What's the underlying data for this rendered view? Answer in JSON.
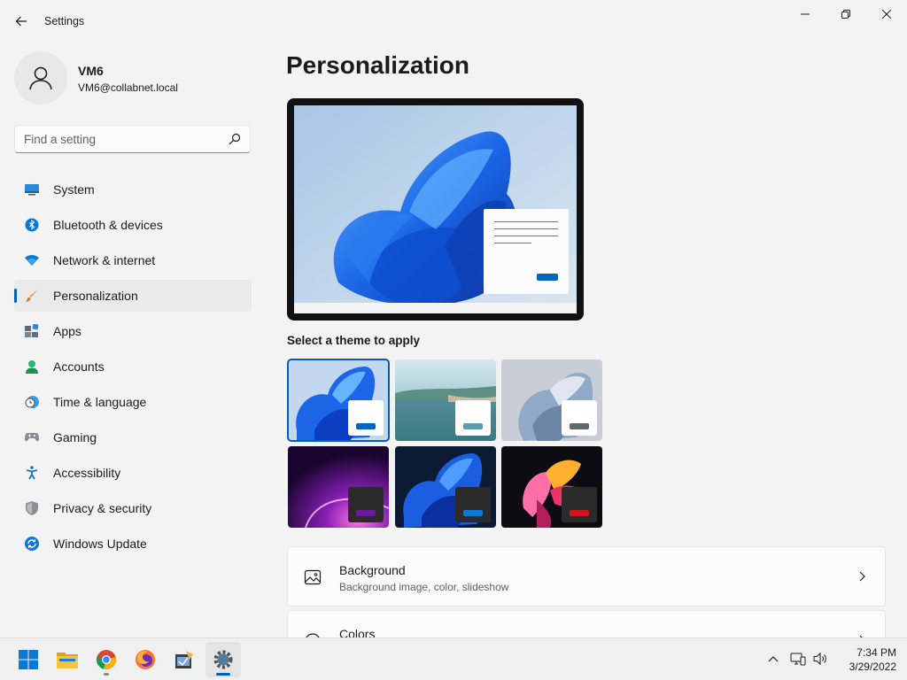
{
  "window": {
    "title": "Settings"
  },
  "profile": {
    "name": "VM6",
    "email": "VM6@collabnet.local"
  },
  "search": {
    "placeholder": "Find a setting"
  },
  "sidebar": {
    "items": [
      {
        "label": "System",
        "icon": "system-icon",
        "selected": false
      },
      {
        "label": "Bluetooth & devices",
        "icon": "bluetooth-icon",
        "selected": false
      },
      {
        "label": "Network & internet",
        "icon": "wifi-icon",
        "selected": false
      },
      {
        "label": "Personalization",
        "icon": "brush-icon",
        "selected": true
      },
      {
        "label": "Apps",
        "icon": "apps-icon",
        "selected": false
      },
      {
        "label": "Accounts",
        "icon": "accounts-icon",
        "selected": false
      },
      {
        "label": "Time & language",
        "icon": "clock-globe-icon",
        "selected": false
      },
      {
        "label": "Gaming",
        "icon": "gamepad-icon",
        "selected": false
      },
      {
        "label": "Accessibility",
        "icon": "accessibility-icon",
        "selected": false
      },
      {
        "label": "Privacy & security",
        "icon": "shield-icon",
        "selected": false
      },
      {
        "label": "Windows Update",
        "icon": "update-icon",
        "selected": false
      }
    ]
  },
  "main": {
    "title": "Personalization",
    "themes_label": "Select a theme to apply",
    "themes": [
      {
        "name": "windows-light",
        "selected": true,
        "accent": "#0067c0"
      },
      {
        "name": "glow",
        "selected": false,
        "accent": "#5a9ea8"
      },
      {
        "name": "captured-motion",
        "selected": false,
        "accent": "#5f6770"
      },
      {
        "name": "sunrise",
        "selected": false,
        "accent": "#6a1b9a"
      },
      {
        "name": "windows-dark",
        "selected": false,
        "accent": "#0a78d4"
      },
      {
        "name": "flow",
        "selected": false,
        "accent": "#d1151f"
      }
    ],
    "cards": [
      {
        "title": "Background",
        "subtitle": "Background image, color, slideshow",
        "icon": "image-icon"
      },
      {
        "title": "Colors",
        "subtitle": "",
        "icon": "palette-icon"
      }
    ]
  },
  "taskbar": {
    "apps": [
      "start-icon",
      "file-explorer-icon",
      "chrome-icon",
      "firefox-icon",
      "app-icon",
      "settings-icon"
    ],
    "time": "7:34 PM",
    "date": "3/29/2022"
  },
  "colors": {
    "accent": "#005fb8",
    "background": "#f3f3f3"
  }
}
